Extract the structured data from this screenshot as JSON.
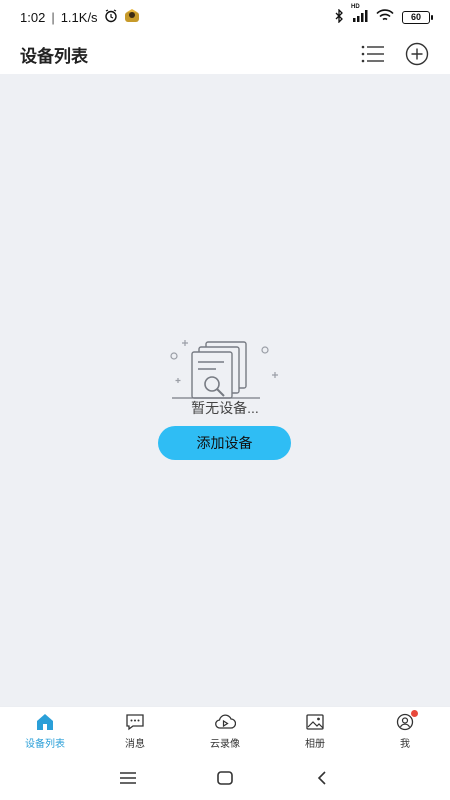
{
  "status": {
    "time": "1:02",
    "speed": "1.1K/s",
    "battery": "60",
    "network": "HD"
  },
  "header": {
    "title": "设备列表"
  },
  "main": {
    "empty_text": "暂无设备...",
    "add_button": "添加设备"
  },
  "tabs": [
    {
      "label": "设备列表",
      "icon": "home-icon",
      "active": true
    },
    {
      "label": "消息",
      "icon": "message-icon"
    },
    {
      "label": "云录像",
      "icon": "cloud-video-icon"
    },
    {
      "label": "相册",
      "icon": "album-icon"
    },
    {
      "label": "我",
      "icon": "profile-icon"
    }
  ],
  "colors": {
    "accent": "#2fbdf4",
    "active_tab": "#2a9fd8",
    "background": "#eef0f4",
    "badge": "#e8493c"
  }
}
